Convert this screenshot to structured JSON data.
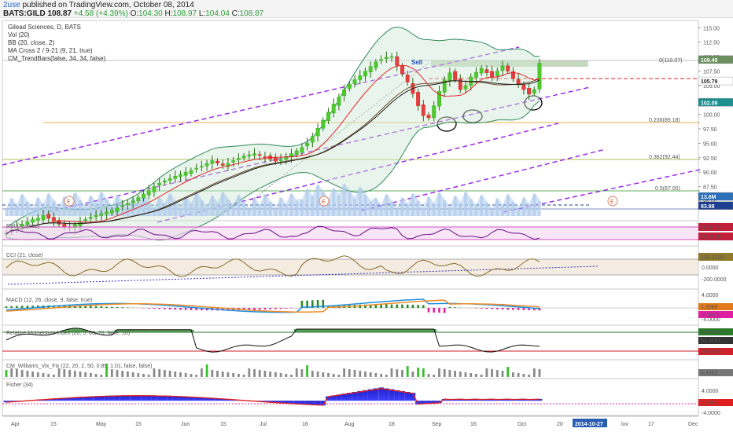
{
  "header": {
    "user": "2use",
    "published": "published on TradingView.com, October 08, 2014",
    "symbol": "BATS:GILD",
    "price": "108.87",
    "change": "+4.58 (+4.39%)",
    "o_label": "O:",
    "o": "104.30",
    "h_label": "H:",
    "h": "108.97",
    "l_label": "L:",
    "l": "104.04",
    "c_label": "C:",
    "c": "108.87"
  },
  "indicators": {
    "main": [
      "Gilead Sciences, D, BATS",
      "Vol (20)",
      "BB (20, close, 2)",
      "MA Cross 2 / 9-21 (9, 21, true)",
      "CM_TrendBars(false, 34, 34, false)"
    ],
    "rsi": "RSI (7, close)",
    "cci": "CCI (21, close)",
    "macd": "MACD (12, 26, close, 9, false, true)",
    "rmi": "Relative Momentum Index (20, 5, 80, 20, false, 10)",
    "willvix": "CM_Williams_Vix_Fix (22, 20, 2, 50, 0.85, 1.01, false, false)",
    "fisher": "Fisher (34)"
  },
  "annotations": {
    "sell": "Sell",
    "fib": [
      "0(110.07)",
      "0.236(89.18)",
      "0.382(92.44)",
      "0.5(87.00)"
    ],
    "earnings": "E"
  },
  "price_axis": {
    "ticks": [
      "115.00",
      "112.50",
      "110.00",
      "107.50",
      "105.00",
      "102.50",
      "100.00",
      "97.50",
      "95.00",
      "92.50",
      "90.00",
      "87.50",
      "85.00"
    ],
    "badges": [
      {
        "text": "109.49",
        "color": "#6b8f5e"
      },
      {
        "text": "105.79",
        "color": "#ffffff"
      },
      {
        "text": "102.09",
        "color": "#1b8f8f"
      },
      {
        "text": "13.6M",
        "color": "#2b6fb8"
      },
      {
        "text": "83.88",
        "color": "#1e3f8f"
      }
    ]
  },
  "rsi_axis": {
    "badges": [
      "68.8773",
      "39.2768"
    ]
  },
  "cci_axis": {
    "ticks": [
      "0.0000",
      "-200.0000"
    ],
    "badges": [
      "135.3220"
    ]
  },
  "macd_axis": {
    "ticks": [
      "4.0000",
      "-4.0000"
    ],
    "badges": [
      "1.3088",
      "-0.3471"
    ]
  },
  "rmi_axis": {
    "badges": [
      "80.0000",
      "52.4051",
      "20.0000"
    ]
  },
  "willvix_axis": {
    "badges": [
      "4.4365"
    ]
  },
  "fisher_axis": {
    "ticks": [
      "4.0000",
      "-4.0000"
    ],
    "badges": [
      "0.6281"
    ]
  },
  "time_axis": {
    "labels": [
      "Apr",
      "15",
      "May",
      "15",
      "Jun",
      "15",
      "Jul",
      "16",
      "Aug",
      "18",
      "Sep",
      "16",
      "Oct",
      "20",
      "2014-10-27",
      "lov",
      "17",
      "Dec"
    ]
  },
  "chart_data": {
    "type": "candlestick",
    "title": "Gilead Sciences, D, BATS",
    "ylim": [
      82,
      116
    ],
    "closes": [
      79.5,
      80,
      80.5,
      81,
      81.4,
      81.8,
      82,
      82.5,
      82,
      81.6,
      81,
      80.6,
      80.5,
      80.9,
      81.4,
      81.8,
      82.2,
      82.5,
      82.8,
      83.1,
      83.4,
      83.8,
      84.2,
      84.6,
      85,
      85.6,
      86.2,
      86.8,
      87.5,
      88.1,
      88.5,
      88.9,
      89.3,
      89.6,
      90,
      90.3,
      90.7,
      91,
      91.5,
      92,
      91.6,
      91.2,
      91.5,
      92,
      92.4,
      92.8,
      93,
      93.2,
      92.9,
      92.6,
      92.3,
      91.9,
      92.2,
      92.7,
      93.2,
      93.7,
      94.3,
      95,
      96.2,
      97.6,
      99,
      100.4,
      101.8,
      103,
      104.3,
      105.2,
      106,
      106.7,
      107.5,
      108.3,
      109.1,
      109.5,
      109.9,
      110,
      108.5,
      107,
      105.6,
      103.6,
      101.5,
      99.8,
      99.4,
      101.5,
      104,
      106,
      107.2,
      106,
      104.3,
      105,
      106.5,
      107.3,
      108,
      107.2,
      106.5,
      107.5,
      108.4,
      107.5,
      106.2,
      105.3,
      104.3,
      103.5,
      104.3,
      108.87
    ],
    "rsi_range": [
      0,
      100
    ],
    "macd_signal_label": "MACD",
    "fisher_range": [
      -6,
      9
    ]
  }
}
